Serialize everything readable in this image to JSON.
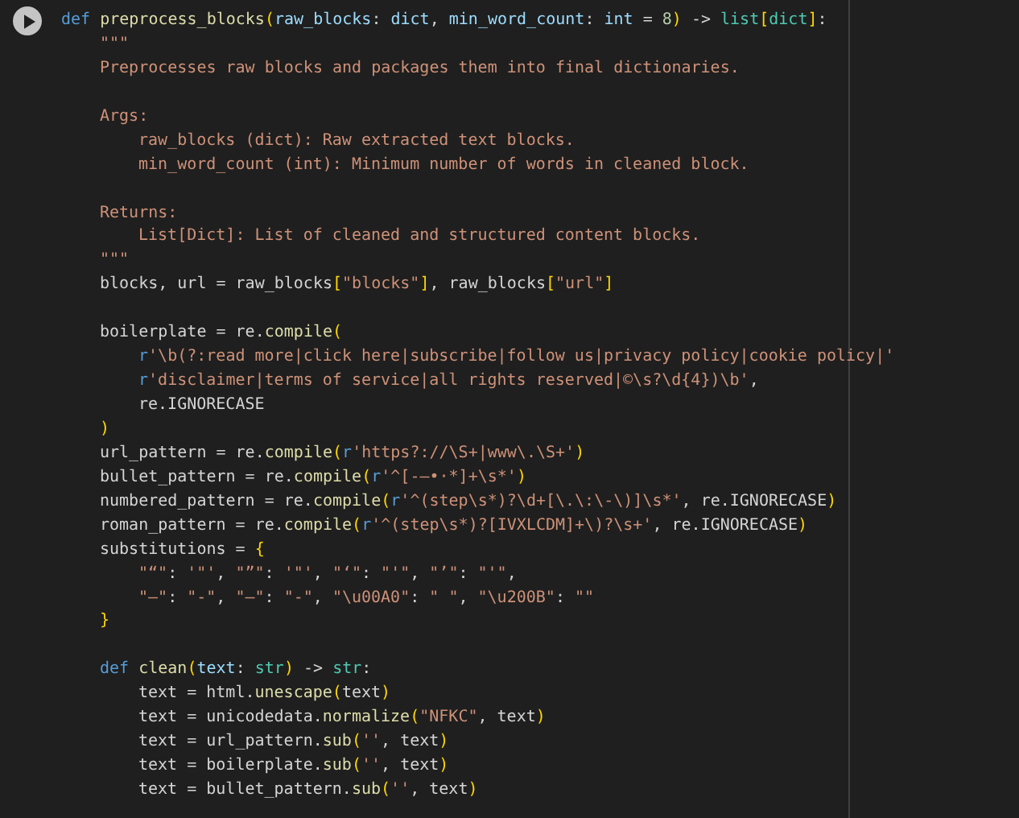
{
  "cell": {
    "run_button": {
      "kind": "play"
    },
    "lines": [
      {
        "kind": "code",
        "tokens": [
          {
            "kind": "kw",
            "text": "def "
          },
          {
            "kind": "fn",
            "text": "preprocess_blocks"
          },
          {
            "kind": "b1",
            "text": "("
          },
          {
            "kind": "param",
            "text": "raw_blocks"
          },
          {
            "kind": "plain",
            "text": ": "
          },
          {
            "kind": "param",
            "text": "dict"
          },
          {
            "kind": "plain",
            "text": ", "
          },
          {
            "kind": "param",
            "text": "min_word_count"
          },
          {
            "kind": "plain",
            "text": ": "
          },
          {
            "kind": "param",
            "text": "int"
          },
          {
            "kind": "plain",
            "text": " = "
          },
          {
            "kind": "num",
            "text": "8"
          },
          {
            "kind": "b1",
            "text": ")"
          },
          {
            "kind": "plain",
            "text": " -> "
          },
          {
            "kind": "type",
            "text": "list"
          },
          {
            "kind": "b1",
            "text": "["
          },
          {
            "kind": "type",
            "text": "dict"
          },
          {
            "kind": "b1",
            "text": "]"
          },
          {
            "kind": "plain",
            "text": ":"
          }
        ],
        "children": [
          {
            "kind": "code",
            "tokens": [
              {
                "kind": "str",
                "text": "\"\"\""
              }
            ]
          },
          {
            "kind": "code",
            "tokens": [
              {
                "kind": "str",
                "text": "Preprocesses raw blocks and packages them into final dictionaries."
              }
            ]
          },
          {
            "kind": "blank"
          },
          {
            "kind": "code",
            "tokens": [
              {
                "kind": "str",
                "text": "Args:"
              }
            ],
            "children": [
              {
                "kind": "code",
                "tokens": [
                  {
                    "kind": "str",
                    "text": "raw_blocks (dict): Raw extracted text blocks."
                  }
                ]
              },
              {
                "kind": "code",
                "tokens": [
                  {
                    "kind": "str",
                    "text": "min_word_count (int): Minimum number of words in cleaned block."
                  }
                ]
              }
            ]
          },
          {
            "kind": "blank"
          },
          {
            "kind": "code",
            "tokens": [
              {
                "kind": "str",
                "text": "Returns:"
              }
            ],
            "children": [
              {
                "kind": "code",
                "tokens": [
                  {
                    "kind": "str",
                    "text": "List[Dict]: List of cleaned and structured content blocks."
                  }
                ]
              }
            ]
          },
          {
            "kind": "code",
            "tokens": [
              {
                "kind": "str",
                "text": "\"\"\""
              }
            ]
          },
          {
            "kind": "code",
            "tokens": [
              {
                "kind": "plain",
                "text": "blocks, url = raw_blocks"
              },
              {
                "kind": "b1",
                "text": "["
              },
              {
                "kind": "str",
                "text": "\"blocks\""
              },
              {
                "kind": "b1",
                "text": "]"
              },
              {
                "kind": "plain",
                "text": ", raw_blocks"
              },
              {
                "kind": "b1",
                "text": "["
              },
              {
                "kind": "str",
                "text": "\"url\""
              },
              {
                "kind": "b1",
                "text": "]"
              }
            ]
          },
          {
            "kind": "blank"
          },
          {
            "kind": "code",
            "tokens": [
              {
                "kind": "plain",
                "text": "boilerplate = re."
              },
              {
                "kind": "fn",
                "text": "compile"
              },
              {
                "kind": "b1",
                "text": "("
              }
            ],
            "children": [
              {
                "kind": "code",
                "tokens": [
                  {
                    "kind": "kw",
                    "text": "r"
                  },
                  {
                    "kind": "str",
                    "text": "'\\b(?:read more|click here|subscribe|follow us|privacy policy|cookie policy|'"
                  }
                ]
              },
              {
                "kind": "code",
                "tokens": [
                  {
                    "kind": "kw",
                    "text": "r"
                  },
                  {
                    "kind": "str",
                    "text": "'disclaimer|terms of service|all rights reserved|©\\s?\\d{4})\\b'"
                  },
                  {
                    "kind": "plain",
                    "text": ","
                  }
                ]
              },
              {
                "kind": "code",
                "tokens": [
                  {
                    "kind": "plain",
                    "text": "re.IGNORECASE"
                  }
                ]
              }
            ]
          },
          {
            "kind": "code",
            "tokens": [
              {
                "kind": "b1",
                "text": ")"
              }
            ]
          },
          {
            "kind": "code",
            "tokens": [
              {
                "kind": "plain",
                "text": "url_pattern = re."
              },
              {
                "kind": "fn",
                "text": "compile"
              },
              {
                "kind": "b1",
                "text": "("
              },
              {
                "kind": "kw",
                "text": "r"
              },
              {
                "kind": "str",
                "text": "'https?://\\S+|www\\.\\S+'"
              },
              {
                "kind": "b1",
                "text": ")"
              }
            ]
          },
          {
            "kind": "code",
            "tokens": [
              {
                "kind": "plain",
                "text": "bullet_pattern = re."
              },
              {
                "kind": "fn",
                "text": "compile"
              },
              {
                "kind": "b1",
                "text": "("
              },
              {
                "kind": "kw",
                "text": "r"
              },
              {
                "kind": "str",
                "text": "'^[-–•·*]+\\s*'"
              },
              {
                "kind": "b1",
                "text": ")"
              }
            ]
          },
          {
            "kind": "code",
            "tokens": [
              {
                "kind": "plain",
                "text": "numbered_pattern = re."
              },
              {
                "kind": "fn",
                "text": "compile"
              },
              {
                "kind": "b1",
                "text": "("
              },
              {
                "kind": "kw",
                "text": "r"
              },
              {
                "kind": "str",
                "text": "'^(step\\s*)?\\d+[\\.\\:\\-\\)]\\s*'"
              },
              {
                "kind": "plain",
                "text": ", re.IGNORECASE"
              },
              {
                "kind": "b1",
                "text": ")"
              }
            ]
          },
          {
            "kind": "code",
            "tokens": [
              {
                "kind": "plain",
                "text": "roman_pattern = re."
              },
              {
                "kind": "fn",
                "text": "compile"
              },
              {
                "kind": "b1",
                "text": "("
              },
              {
                "kind": "kw",
                "text": "r"
              },
              {
                "kind": "str",
                "text": "'^(step\\s*)?[IVXLCDM]+\\)?\\s+'"
              },
              {
                "kind": "plain",
                "text": ", re.IGNORECASE"
              },
              {
                "kind": "b1",
                "text": ")"
              }
            ]
          },
          {
            "kind": "code",
            "tokens": [
              {
                "kind": "plain",
                "text": "substitutions = "
              },
              {
                "kind": "b1",
                "text": "{"
              }
            ],
            "children": [
              {
                "kind": "code",
                "tokens": [
                  {
                    "kind": "str",
                    "text": "\"“\""
                  },
                  {
                    "kind": "plain",
                    "text": ": "
                  },
                  {
                    "kind": "str",
                    "text": "'\"'"
                  },
                  {
                    "kind": "plain",
                    "text": ", "
                  },
                  {
                    "kind": "str",
                    "text": "\"”\""
                  },
                  {
                    "kind": "plain",
                    "text": ": "
                  },
                  {
                    "kind": "str",
                    "text": "'\"'"
                  },
                  {
                    "kind": "plain",
                    "text": ", "
                  },
                  {
                    "kind": "str",
                    "text": "\"‘\""
                  },
                  {
                    "kind": "plain",
                    "text": ": "
                  },
                  {
                    "kind": "str",
                    "text": "\"'\""
                  },
                  {
                    "kind": "plain",
                    "text": ", "
                  },
                  {
                    "kind": "str",
                    "text": "\"’\""
                  },
                  {
                    "kind": "plain",
                    "text": ": "
                  },
                  {
                    "kind": "str",
                    "text": "\"'\""
                  },
                  {
                    "kind": "plain",
                    "text": ","
                  }
                ]
              },
              {
                "kind": "code",
                "tokens": [
                  {
                    "kind": "str",
                    "text": "\"–\""
                  },
                  {
                    "kind": "plain",
                    "text": ": "
                  },
                  {
                    "kind": "str",
                    "text": "\"-\""
                  },
                  {
                    "kind": "plain",
                    "text": ", "
                  },
                  {
                    "kind": "str",
                    "text": "\"—\""
                  },
                  {
                    "kind": "plain",
                    "text": ": "
                  },
                  {
                    "kind": "str",
                    "text": "\"-\""
                  },
                  {
                    "kind": "plain",
                    "text": ", "
                  },
                  {
                    "kind": "str",
                    "text": "\"\\u00A0\""
                  },
                  {
                    "kind": "plain",
                    "text": ": "
                  },
                  {
                    "kind": "str",
                    "text": "\" \""
                  },
                  {
                    "kind": "plain",
                    "text": ", "
                  },
                  {
                    "kind": "str",
                    "text": "\"\\u200B\""
                  },
                  {
                    "kind": "plain",
                    "text": ": "
                  },
                  {
                    "kind": "str",
                    "text": "\"\""
                  }
                ]
              }
            ]
          },
          {
            "kind": "code",
            "tokens": [
              {
                "kind": "b1",
                "text": "}"
              }
            ]
          },
          {
            "kind": "blank"
          },
          {
            "kind": "code",
            "tokens": [
              {
                "kind": "kw",
                "text": "def "
              },
              {
                "kind": "fn",
                "text": "clean"
              },
              {
                "kind": "b1",
                "text": "("
              },
              {
                "kind": "param",
                "text": "text"
              },
              {
                "kind": "plain",
                "text": ": "
              },
              {
                "kind": "type",
                "text": "str"
              },
              {
                "kind": "b1",
                "text": ")"
              },
              {
                "kind": "plain",
                "text": " -> "
              },
              {
                "kind": "type",
                "text": "str"
              },
              {
                "kind": "plain",
                "text": ":"
              }
            ],
            "children": [
              {
                "kind": "code",
                "tokens": [
                  {
                    "kind": "plain",
                    "text": "text = html."
                  },
                  {
                    "kind": "fn",
                    "text": "unescape"
                  },
                  {
                    "kind": "b1",
                    "text": "("
                  },
                  {
                    "kind": "plain",
                    "text": "text"
                  },
                  {
                    "kind": "b1",
                    "text": ")"
                  }
                ]
              },
              {
                "kind": "code",
                "tokens": [
                  {
                    "kind": "plain",
                    "text": "text = unicodedata."
                  },
                  {
                    "kind": "fn",
                    "text": "normalize"
                  },
                  {
                    "kind": "b1",
                    "text": "("
                  },
                  {
                    "kind": "str",
                    "text": "\"NFKC\""
                  },
                  {
                    "kind": "plain",
                    "text": ", text"
                  },
                  {
                    "kind": "b1",
                    "text": ")"
                  }
                ]
              },
              {
                "kind": "code",
                "tokens": [
                  {
                    "kind": "plain",
                    "text": "text = url_pattern."
                  },
                  {
                    "kind": "fn",
                    "text": "sub"
                  },
                  {
                    "kind": "b1",
                    "text": "("
                  },
                  {
                    "kind": "str",
                    "text": "''"
                  },
                  {
                    "kind": "plain",
                    "text": ", text"
                  },
                  {
                    "kind": "b1",
                    "text": ")"
                  }
                ]
              },
              {
                "kind": "code",
                "tokens": [
                  {
                    "kind": "plain",
                    "text": "text = boilerplate."
                  },
                  {
                    "kind": "fn",
                    "text": "sub"
                  },
                  {
                    "kind": "b1",
                    "text": "("
                  },
                  {
                    "kind": "str",
                    "text": "''"
                  },
                  {
                    "kind": "plain",
                    "text": ", text"
                  },
                  {
                    "kind": "b1",
                    "text": ")"
                  }
                ]
              },
              {
                "kind": "code",
                "tokens": [
                  {
                    "kind": "plain",
                    "text": "text = bullet_pattern."
                  },
                  {
                    "kind": "fn",
                    "text": "sub"
                  },
                  {
                    "kind": "b1",
                    "text": "("
                  },
                  {
                    "kind": "str",
                    "text": "''"
                  },
                  {
                    "kind": "plain",
                    "text": ", text"
                  },
                  {
                    "kind": "b1",
                    "text": ")"
                  }
                ]
              }
            ]
          }
        ]
      }
    ]
  }
}
